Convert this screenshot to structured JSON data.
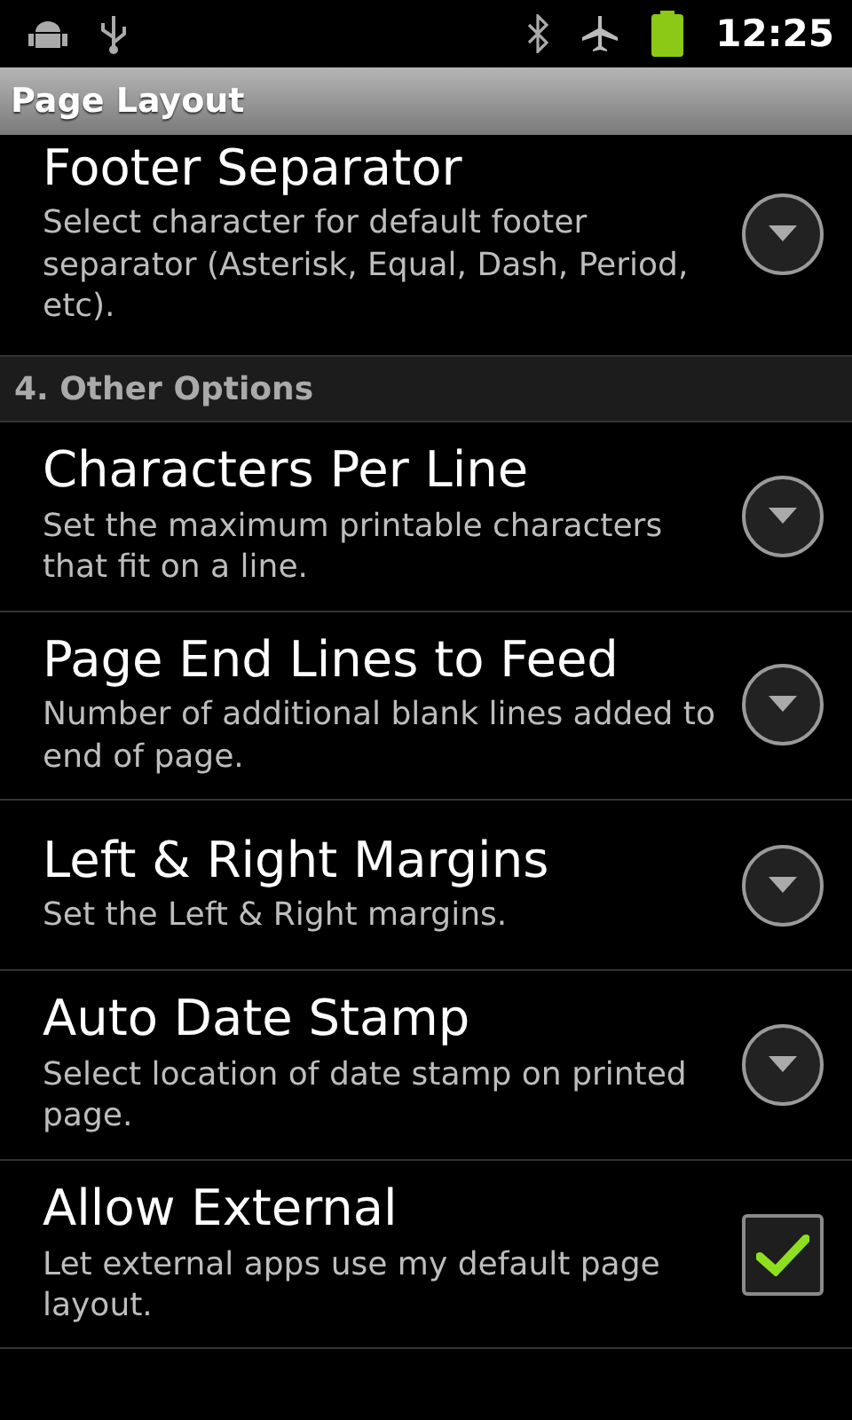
{
  "status_bar": {
    "time": "12:25"
  },
  "title_bar": {
    "title": "Page Layout"
  },
  "sections": [
    {
      "kind": "items",
      "items": [
        {
          "kind": "dropdown",
          "title": "Footer Separator",
          "summary": "Select character for default footer separator (Asterisk, Equal, Dash, Period, etc)."
        }
      ]
    },
    {
      "kind": "header",
      "title": "4. Other Options",
      "items": [
        {
          "kind": "dropdown",
          "title": "Characters Per Line",
          "summary": "Set the maximum printable characters that fit on a line."
        },
        {
          "kind": "dropdown",
          "title": "Page End Lines to Feed",
          "summary": "Number of additional blank lines added to end of page."
        },
        {
          "kind": "dropdown",
          "title": "Left & Right Margins",
          "summary": "Set the Left & Right margins."
        },
        {
          "kind": "dropdown",
          "title": "Auto Date Stamp",
          "summary": "Select location of date stamp on printed page."
        },
        {
          "kind": "checkbox",
          "title": "Allow External",
          "summary": "Let external apps use my default page layout.",
          "checked": true
        }
      ]
    }
  ]
}
